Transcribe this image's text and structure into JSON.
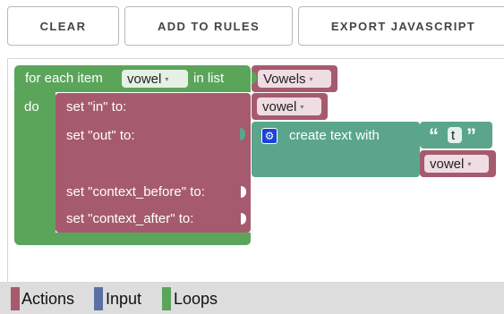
{
  "toolbar": {
    "clear_label": "CLEAR",
    "add_rules_label": "ADD TO RULES",
    "export_label": "EXPORT JAVASCRIPT"
  },
  "blocks": {
    "for_each": {
      "prefix": "for each item",
      "variable": "vowel",
      "in_list": "in list",
      "list_value": "Vowels",
      "do_label": "do"
    },
    "set_in": {
      "label": "set \"in\" to:",
      "value": "vowel"
    },
    "set_out": {
      "label": "set \"out\" to:"
    },
    "create_text": {
      "label": "create text with",
      "open_quote": "“",
      "text_value": "t",
      "close_quote": "”",
      "variable": "vowel"
    },
    "set_context_before": {
      "label": "set \"context_before\" to:"
    },
    "set_context_after": {
      "label": "set \"context_after\" to:"
    }
  },
  "legend": {
    "items": [
      {
        "label": "Actions",
        "color": "#a55b6d"
      },
      {
        "label": "Input",
        "color": "#5b6fa5"
      },
      {
        "label": "Loops",
        "color": "#5ba55b"
      }
    ]
  },
  "colors": {
    "loop_green": "#5ba55b",
    "action_red": "#a55b6d",
    "text_teal": "#5ba58c",
    "variable_pink": "#a55b80",
    "input_blue": "#5b6fa5"
  }
}
